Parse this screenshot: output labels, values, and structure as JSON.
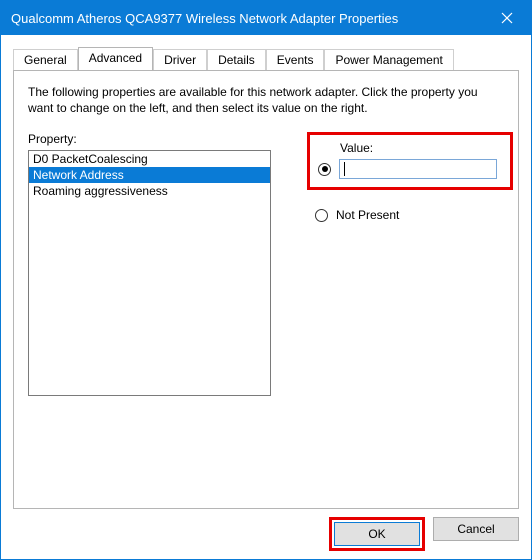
{
  "window": {
    "title": "Qualcomm Atheros QCA9377 Wireless Network Adapter Properties"
  },
  "tabs": {
    "general": "General",
    "advanced": "Advanced",
    "driver": "Driver",
    "details": "Details",
    "events": "Events",
    "power": "Power Management"
  },
  "description": "The following properties are available for this network adapter. Click the property you want to change on the left, and then select its value on the right.",
  "property_label": "Property:",
  "properties": {
    "items": [
      "D0 PacketCoalescing",
      "Network Address",
      "Roaming aggressiveness"
    ],
    "selected_index": 1
  },
  "value": {
    "label": "Value:",
    "current": "",
    "not_present_label": "Not Present",
    "selected_option": "value"
  },
  "buttons": {
    "ok": "OK",
    "cancel": "Cancel"
  }
}
